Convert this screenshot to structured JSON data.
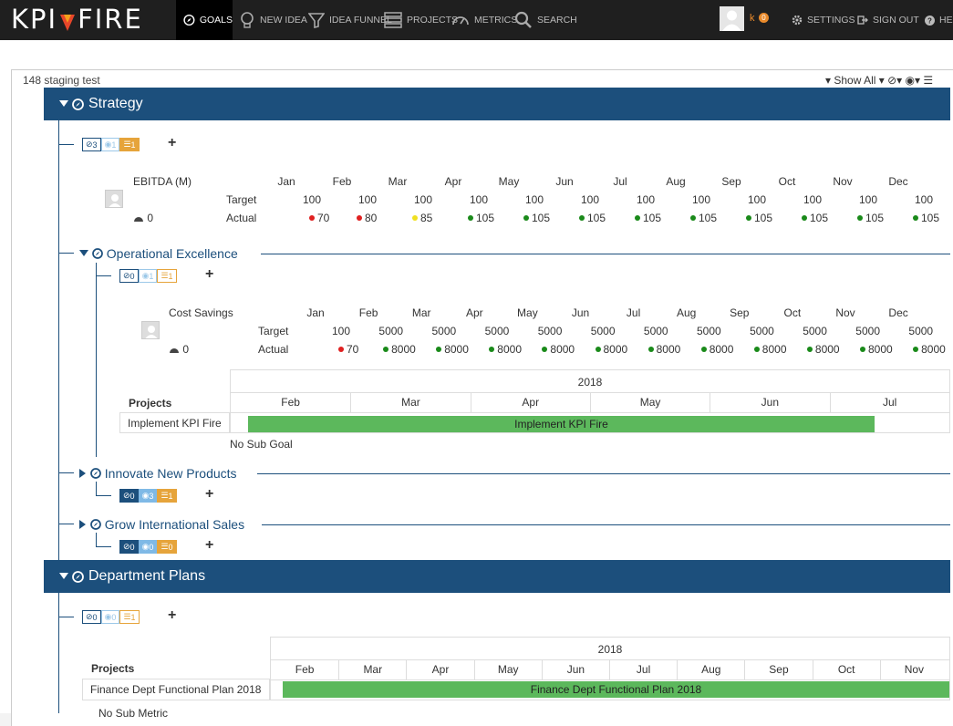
{
  "nav": {
    "logo_left": "KPI",
    "logo_right": "FIRE",
    "items": [
      "GOALS",
      "NEW IDEA",
      "IDEA FUNNEL",
      "PROJECTS",
      "METRICS",
      "SEARCH"
    ],
    "user_initial": "k",
    "user_count": "0",
    "right_items": [
      "SETTINGS",
      "SIGN OUT",
      "HELP"
    ]
  },
  "frame": {
    "title": "148 staging test",
    "show_all": "Show All"
  },
  "months": [
    "Jan",
    "Feb",
    "Mar",
    "Apr",
    "May",
    "Jun",
    "Jul",
    "Aug",
    "Sep",
    "Oct",
    "Nov",
    "Dec"
  ],
  "labels": {
    "target": "Target",
    "actual": "Actual",
    "projects": "Projects",
    "no_sub_goal": "No Sub Goal",
    "no_sub_metric": "No Sub Metric"
  },
  "strategy": {
    "title": "Strategy",
    "badges": {
      "goals": "3",
      "metrics": "1",
      "projects": "1"
    },
    "metric": {
      "name": "EBITDA (M)",
      "gauge": "0",
      "targets": [
        "100",
        "100",
        "100",
        "100",
        "100",
        "100",
        "100",
        "100",
        "100",
        "100",
        "100",
        "100"
      ],
      "actuals": [
        "70",
        "80",
        "85",
        "105",
        "105",
        "105",
        "105",
        "105",
        "105",
        "105",
        "105",
        "105"
      ],
      "status": [
        "red",
        "red",
        "yellow",
        "green",
        "green",
        "green",
        "green",
        "green",
        "green",
        "green",
        "green",
        "green"
      ]
    }
  },
  "operational": {
    "title": "Operational Excellence",
    "badges": {
      "goals": "0",
      "metrics": "1",
      "projects": "1"
    },
    "metric": {
      "name": "Cost Savings",
      "gauge": "0",
      "targets": [
        "100",
        "5000",
        "5000",
        "5000",
        "5000",
        "5000",
        "5000",
        "5000",
        "5000",
        "5000",
        "5000",
        "5000"
      ],
      "actuals": [
        "70",
        "8000",
        "8000",
        "8000",
        "8000",
        "8000",
        "8000",
        "8000",
        "8000",
        "8000",
        "8000",
        "8000"
      ],
      "status": [
        "red",
        "green",
        "green",
        "green",
        "green",
        "green",
        "green",
        "green",
        "green",
        "green",
        "green",
        "green"
      ]
    },
    "gantt": {
      "year": "2018",
      "months": [
        "Feb",
        "Mar",
        "Apr",
        "May",
        "Jun",
        "Jul"
      ],
      "project": "Implement KPI Fire",
      "bar_label": "Implement KPI Fire"
    }
  },
  "innovate": {
    "title": "Innovate New Products",
    "badges": {
      "goals": "0",
      "metrics": "3",
      "projects": "1"
    }
  },
  "grow": {
    "title": "Grow International Sales",
    "badges": {
      "goals": "0",
      "metrics": "0",
      "projects": "0"
    }
  },
  "dept": {
    "title": "Department Plans",
    "badges": {
      "goals": "0",
      "metrics": "0",
      "projects": "1"
    },
    "gantt": {
      "year": "2018",
      "months": [
        "Feb",
        "Mar",
        "Apr",
        "May",
        "Jun",
        "Jul",
        "Aug",
        "Sep",
        "Oct",
        "Nov"
      ],
      "project": "Finance Dept Functional Plan 2018",
      "bar_label": "Finance Dept Functional Plan 2018"
    }
  },
  "colors": {
    "navy": "#1c4f7c",
    "red": "#e02020",
    "yellow": "#f0e020",
    "green": "#1a8a1a",
    "bar": "#5cb85c"
  }
}
